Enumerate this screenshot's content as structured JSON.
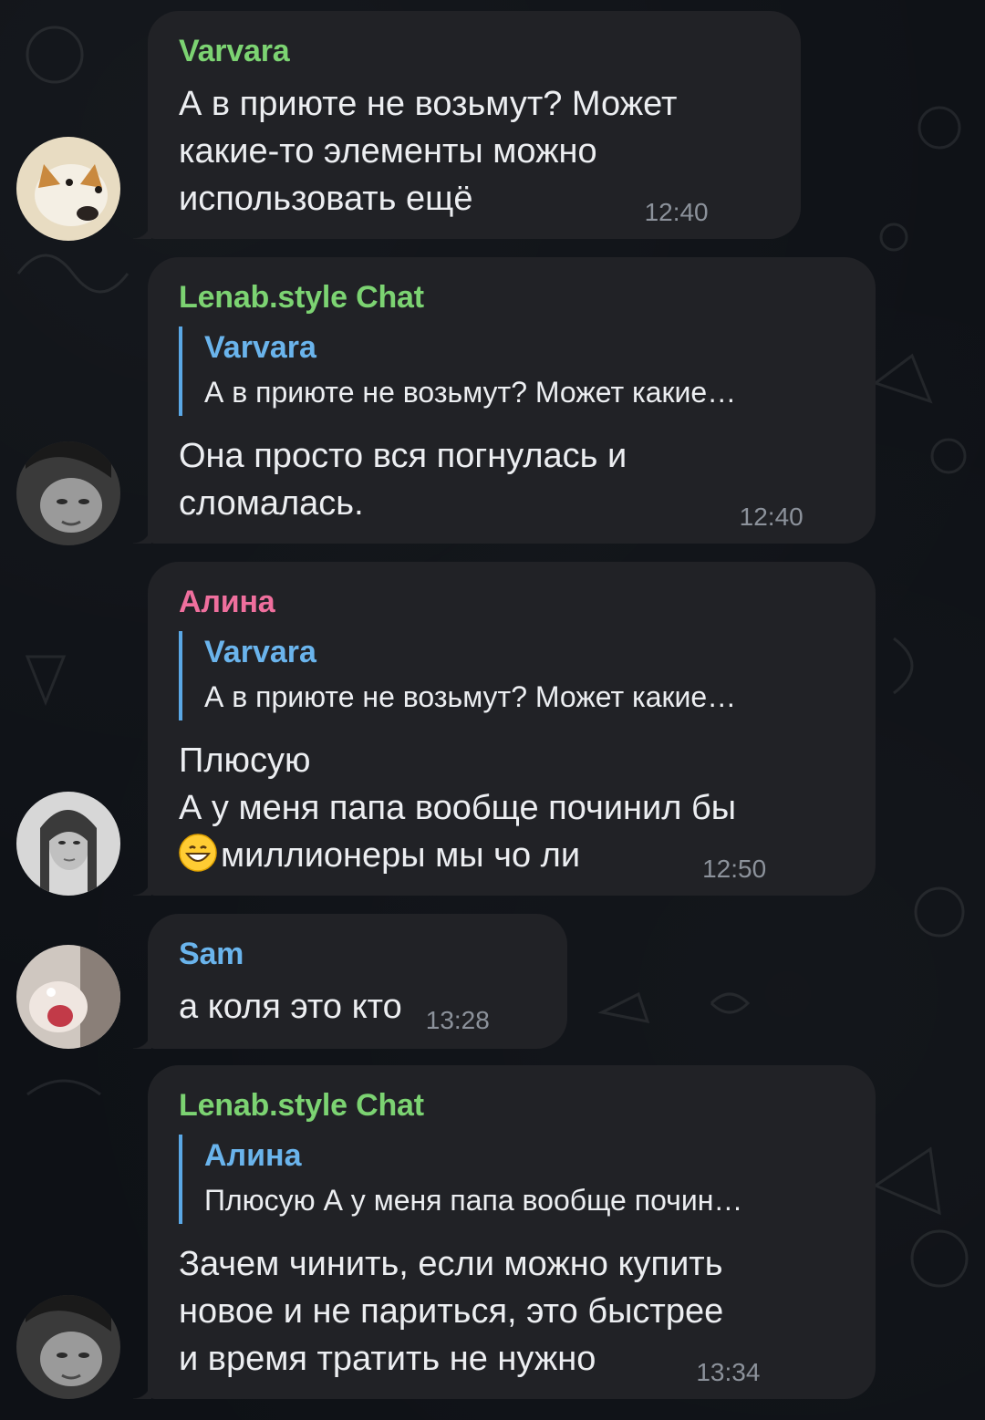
{
  "messages": [
    {
      "sender": "Varvara",
      "sender_color": "#7cd372",
      "text_lines": [
        "А в приюте не возьмут? Может",
        "какие-то элементы можно",
        "использовать ещё"
      ],
      "time": "12:40"
    },
    {
      "sender": "Lenab.style Chat",
      "sender_color": "#7cd372",
      "reply_name": "Varvara",
      "reply_text": "А в приюте не возьмут? Может какие…",
      "text_lines": [
        "Она просто вся погнулась и",
        "сломалась."
      ],
      "time": "12:40"
    },
    {
      "sender": "Алина",
      "sender_color": "#ef6f9d",
      "reply_name": "Varvara",
      "reply_text": "А в приюте не возьмут? Может какие…",
      "text_lines": [
        "Плюсую",
        "А у меня папа вообще починил бы",
        "миллионеры мы чо ли"
      ],
      "emoji": "grinning-face-emoji",
      "time": "12:50"
    },
    {
      "sender": "Sam",
      "sender_color": "#6ab4ec",
      "text_lines": [
        "а коля это кто"
      ],
      "time": "13:28"
    },
    {
      "sender": "Lenab.style Chat",
      "sender_color": "#7cd372",
      "reply_name": "Алина",
      "reply_text": "Плюсую А у меня папа вообще почин…",
      "text_lines": [
        "Зачем чинить, если можно купить",
        "новое и не париться, это быстрее",
        "и время тратить не нужно"
      ],
      "time": "13:34"
    }
  ]
}
